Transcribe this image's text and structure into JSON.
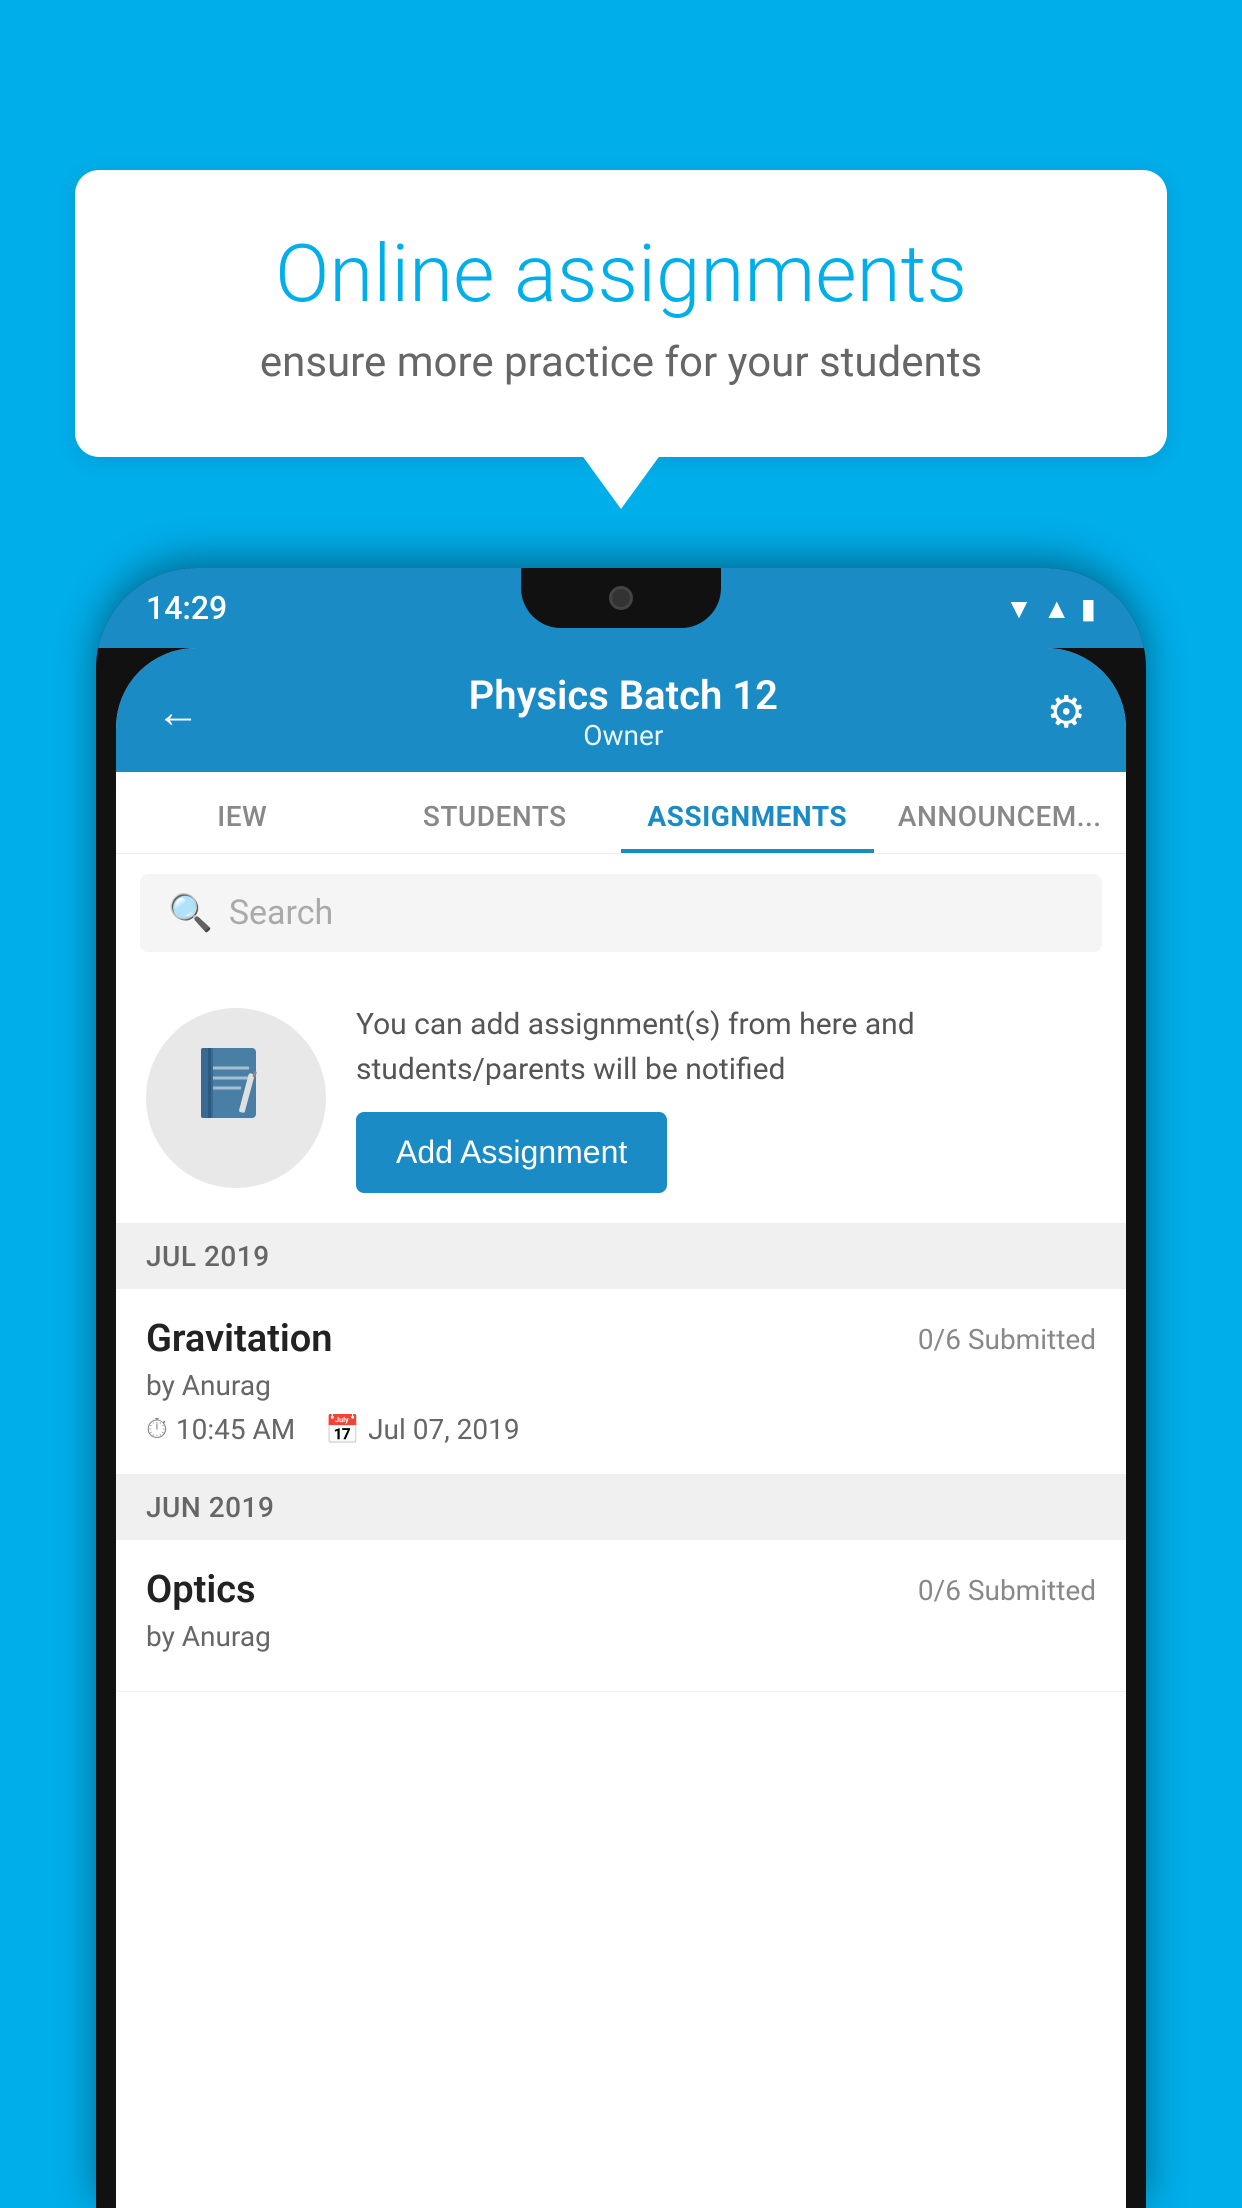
{
  "background": {
    "color": "#00AEEA"
  },
  "speech_bubble": {
    "title": "Online assignments",
    "subtitle": "ensure more practice for your students"
  },
  "phone": {
    "status_bar": {
      "time": "14:29",
      "wifi_icon": "wifi",
      "signal_icon": "signal",
      "battery_icon": "battery"
    },
    "header": {
      "back_label": "←",
      "title": "Physics Batch 12",
      "subtitle": "Owner",
      "settings_icon": "⚙"
    },
    "tabs": [
      {
        "label": "IEW",
        "active": false
      },
      {
        "label": "STUDENTS",
        "active": false
      },
      {
        "label": "ASSIGNMENTS",
        "active": true
      },
      {
        "label": "ANNOUNCEM...",
        "active": false
      }
    ],
    "search": {
      "placeholder": "Search"
    },
    "promo": {
      "icon": "📓",
      "text": "You can add assignment(s) from here and students/parents will be notified",
      "button_label": "Add Assignment"
    },
    "sections": [
      {
        "label": "JUL 2019",
        "assignments": [
          {
            "name": "Gravitation",
            "submitted": "0/6 Submitted",
            "author": "by Anurag",
            "time": "10:45 AM",
            "date": "Jul 07, 2019"
          }
        ]
      },
      {
        "label": "JUN 2019",
        "assignments": [
          {
            "name": "Optics",
            "submitted": "0/6 Submitted",
            "author": "by Anurag",
            "time": "",
            "date": ""
          }
        ]
      }
    ]
  }
}
